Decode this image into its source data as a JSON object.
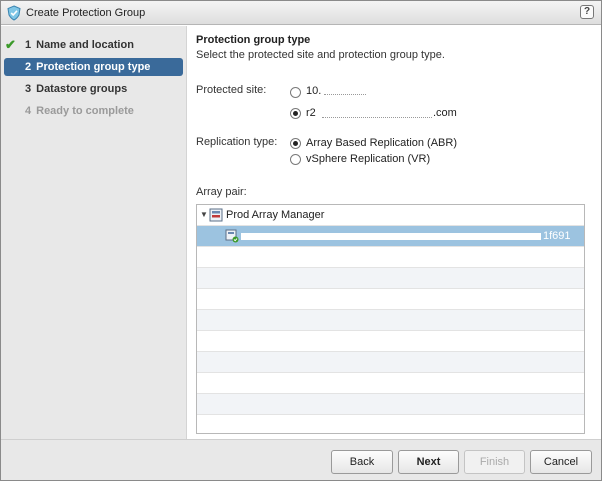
{
  "window": {
    "title": "Create Protection Group",
    "help_label": "?"
  },
  "sidebar": {
    "steps": [
      {
        "num": "1",
        "label": "Name and location",
        "state": "done"
      },
      {
        "num": "2",
        "label": "Protection group type",
        "state": "active"
      },
      {
        "num": "3",
        "label": "Datastore groups",
        "state": "normal"
      },
      {
        "num": "4",
        "label": "Ready to complete",
        "state": "disabled"
      }
    ],
    "check_glyph": "✔"
  },
  "main": {
    "section_title": "Protection group type",
    "section_subtitle": "Select the protected site and protection group type.",
    "protected_site_label": "Protected site:",
    "protected_site_options": [
      {
        "label": "10.",
        "selected": false
      },
      {
        "label": "r2",
        "suffix": ".com",
        "selected": true
      }
    ],
    "replication_type_label": "Replication type:",
    "replication_options": [
      {
        "label": "Array Based Replication (ABR)",
        "selected": true
      },
      {
        "label": "vSphere Replication (VR)",
        "selected": false
      }
    ],
    "array_pair_label": "Array pair:",
    "array_pair_tree": {
      "root_label": "Prod Array Manager",
      "expanded_glyph": "▼",
      "pair_label": "1f691",
      "pair_selected": true,
      "empty_rows": 9
    }
  },
  "footer": {
    "back_label": "Back",
    "next_label": "Next",
    "finish_label": "Finish",
    "cancel_label": "Cancel"
  },
  "colors": {
    "accent": "#3a6a9a",
    "selection": "#9cc3e0",
    "check": "#3b9a2a"
  }
}
